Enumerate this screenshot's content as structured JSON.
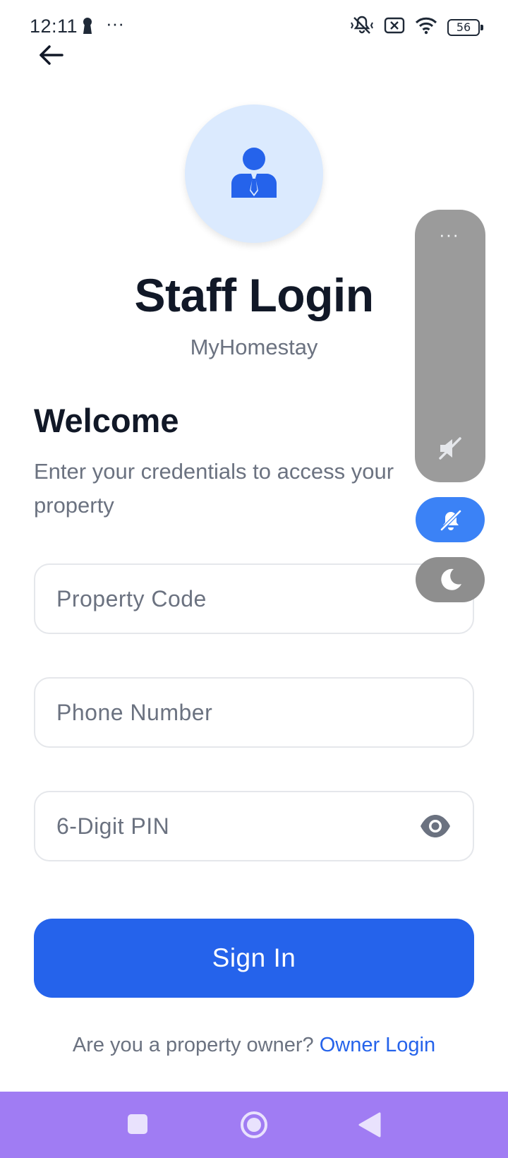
{
  "status_bar": {
    "time": "12:11",
    "overflow": "···",
    "battery": "56"
  },
  "header": {
    "back_icon": "arrow-left-icon"
  },
  "hero": {
    "avatar_icon": "staff-person-icon",
    "title": "Staff Login",
    "subtitle": "MyHomestay"
  },
  "welcome": {
    "heading": "Welcome",
    "description": "Enter your credentials to access your property"
  },
  "form": {
    "property_code_placeholder": "Property Code",
    "phone_placeholder": "Phone Number",
    "pin_placeholder": "6-Digit PIN",
    "pin_toggle_icon": "eye-icon",
    "submit_label": "Sign In"
  },
  "footer": {
    "owner_prompt": "Are you a property owner? ",
    "owner_link": "Owner Login"
  },
  "floating_panel": {
    "menu_dots": "···"
  },
  "colors": {
    "primary": "#2563eb",
    "avatar_bg": "#dbeafe",
    "nav_bar": "#a07cf3"
  }
}
